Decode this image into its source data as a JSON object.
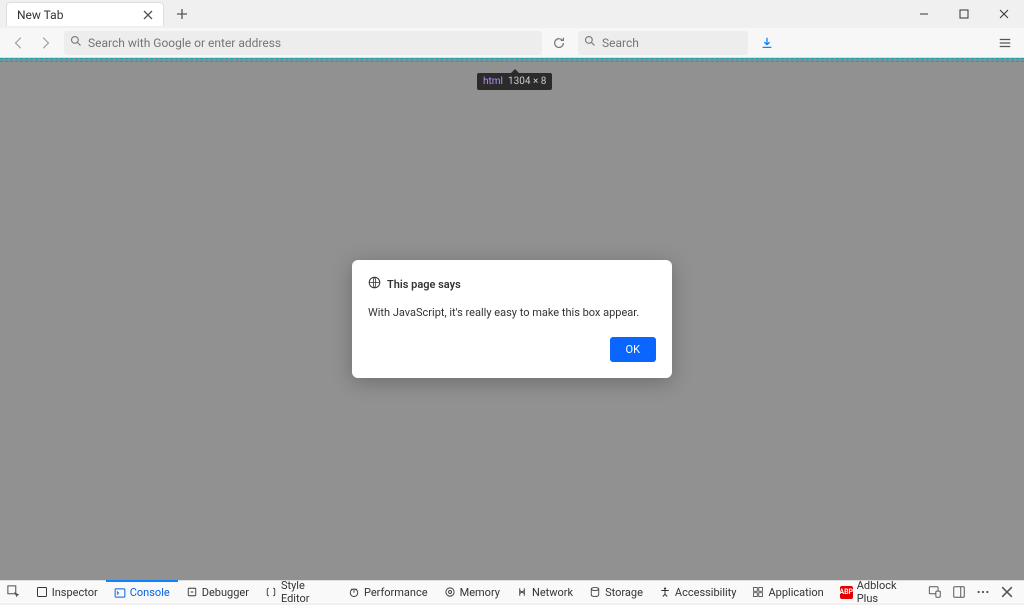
{
  "tab": {
    "title": "New Tab"
  },
  "toolbar": {
    "url_placeholder": "Search with Google or enter address",
    "search_placeholder": "Search"
  },
  "tooltip": {
    "tag": "html",
    "dims": "1304 × 8"
  },
  "dialog": {
    "title": "This page says",
    "message": "With JavaScript, it's really easy to make this box appear.",
    "ok": "OK"
  },
  "devtools": {
    "tabs": [
      "Inspector",
      "Console",
      "Debugger",
      "Style Editor",
      "Performance",
      "Memory",
      "Network",
      "Storage",
      "Accessibility",
      "Application",
      "Adblock Plus"
    ]
  }
}
